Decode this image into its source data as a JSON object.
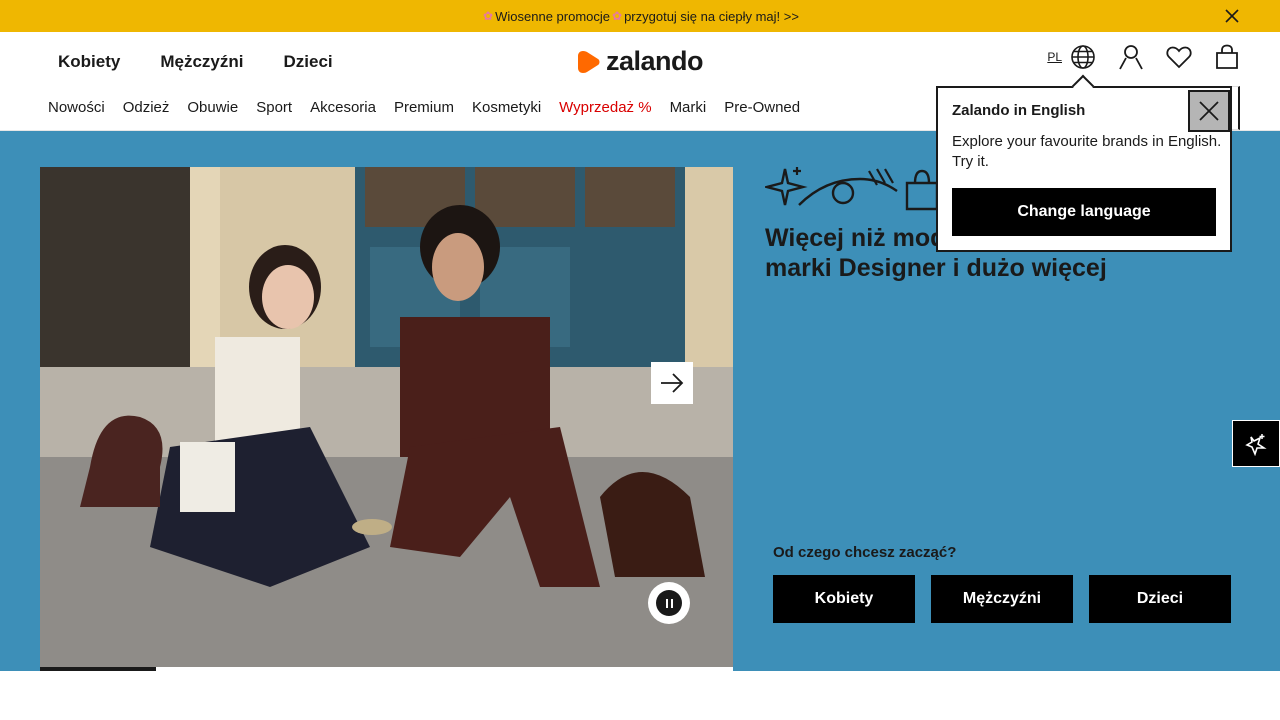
{
  "promo": {
    "text_before": "Wiosenne promocje",
    "text_after": "przygotuj się na ciepły maj! >>"
  },
  "header": {
    "gender_nav": [
      "Kobiety",
      "Mężczyźni",
      "Dzieci"
    ],
    "logo_text": "zalando",
    "language": "PL",
    "categories": [
      "Nowości",
      "Odzież",
      "Obuwie",
      "Sport",
      "Akcesoria",
      "Premium",
      "Kosmetyki",
      "Wyprzedaż %",
      "Marki",
      "Pre-Owned"
    ]
  },
  "hero": {
    "title": "Więcej niż moda. Moda, kosmetyki, marki Designer i dużo więcej",
    "cta_label": "Od czego chcesz zacząć?",
    "cta_buttons": [
      "Kobiety",
      "Mężczyźni",
      "Dzieci"
    ],
    "carousel_progress": 0.167
  },
  "popup": {
    "title": "Zalando in English",
    "body": "Explore your favourite brands in English. Try it.",
    "button": "Change language"
  },
  "colors": {
    "promo_bg": "#efb701",
    "hero_bg": "#3d8fb8",
    "logo_orange": "#ff6900",
    "sale_red": "#d90000"
  },
  "icons": [
    "close-icon",
    "globe-icon",
    "user-icon",
    "heart-icon",
    "bag-icon",
    "arrow-right-icon",
    "pause-icon",
    "sparkle-icon"
  ]
}
